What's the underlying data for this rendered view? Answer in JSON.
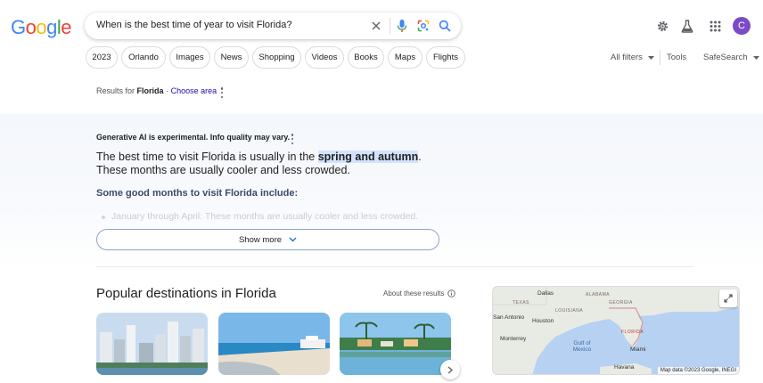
{
  "logo": {
    "letters": [
      {
        "ch": "G",
        "color": "#4285F4"
      },
      {
        "ch": "o",
        "color": "#EA4335"
      },
      {
        "ch": "o",
        "color": "#FBBC05"
      },
      {
        "ch": "g",
        "color": "#4285F4"
      },
      {
        "ch": "l",
        "color": "#34A853"
      },
      {
        "ch": "e",
        "color": "#EA4335"
      }
    ]
  },
  "search": {
    "query": "When is the best time of year to visit Florida?"
  },
  "header": {
    "avatar_letter": "C"
  },
  "chips": [
    "2023",
    "Orlando",
    "Images",
    "News",
    "Shopping",
    "Videos",
    "Books",
    "Maps",
    "Flights"
  ],
  "tools": {
    "all_filters": "All filters",
    "tools": "Tools",
    "safesearch": "SafeSearch"
  },
  "results_for": {
    "prefix": "Results for",
    "place": "Florida",
    "separator": "·",
    "choose_area": "Choose area"
  },
  "ai": {
    "note": "Generative AI is experimental. Info quality may vary.",
    "answer_before": "The best time to visit Florida is usually in the ",
    "answer_highlight": "spring and autumn",
    "answer_after": ". These months are usually cooler and less crowded.",
    "subheading": "Some good months to visit Florida include:",
    "faded_item": "January through April: These months are usually cooler and less crowded.",
    "show_more": "Show more"
  },
  "popular": {
    "title": "Popular destinations in Florida",
    "about": "About these results"
  },
  "map": {
    "cities": [
      "Dallas",
      "Houston",
      "San Antonio",
      "Monterrey",
      "Miami",
      "Havana"
    ],
    "states": [
      "ALABAMA",
      "GEORGIA",
      "LOUISIANA",
      "TEXAS",
      "FLORIDA"
    ],
    "water": "Gulf of Mexico",
    "copyright": "Map data ©2023 Google, INEGI"
  },
  "colors": {
    "link": "#1a0dab",
    "highlight": "#d3e3fd",
    "avatar": "#7b4bc6"
  }
}
